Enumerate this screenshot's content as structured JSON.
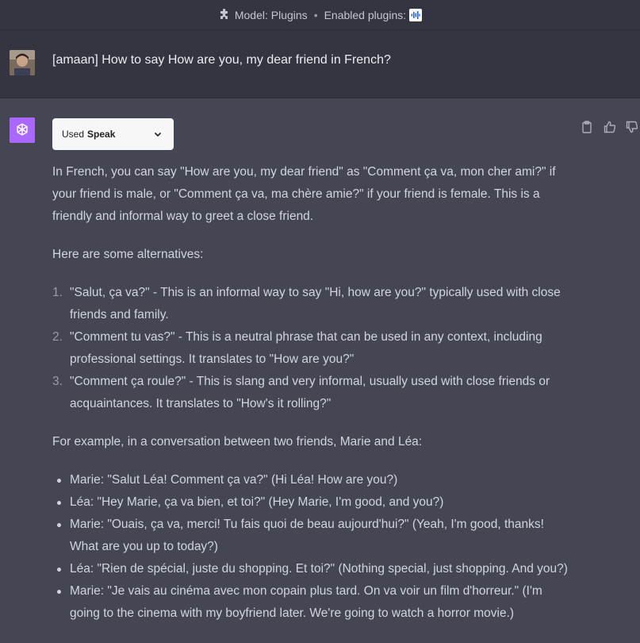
{
  "header": {
    "model_label": "Model: Plugins",
    "separator": "•",
    "enabled_plugins_label": "Enabled plugins:"
  },
  "user_message": {
    "text": "[amaan] How to say How are you, my dear friend in French?"
  },
  "assistant": {
    "plugin_pill": {
      "prefix": "Used",
      "name": "Speak"
    },
    "intro": "In French, you can say \"How are you, my dear friend\" as \"Comment ça va, mon cher ami?\" if your friend is male, or \"Comment ça va, ma chère amie?\" if your friend is female. This is a friendly and informal way to greet a close friend.",
    "alternatives_heading": "Here are some alternatives:",
    "alternatives": [
      {
        "num": "1.",
        "text": "\"Salut, ça va?\" - This is an informal way to say \"Hi, how are you?\" typically used with close friends and family."
      },
      {
        "num": "2.",
        "text": "\"Comment tu vas?\" - This is a neutral phrase that can be used in any context, including professional settings. It translates to \"How are you?\""
      },
      {
        "num": "3.",
        "text": "\"Comment ça roule?\" - This is slang and very informal, usually used with close friends or acquaintances. It translates to \"How's it rolling?\""
      }
    ],
    "example_heading": "For example, in a conversation between two friends, Marie and Léa:",
    "dialogue": [
      "Marie: \"Salut Léa! Comment ça va?\" (Hi Léa! How are you?)",
      "Léa: \"Hey Marie, ça va bien, et toi?\" (Hey Marie, I'm good, and you?)",
      "Marie: \"Ouais, ça va, merci! Tu fais quoi de beau aujourd'hui?\" (Yeah, I'm good, thanks! What are you up to today?)",
      "Léa: \"Rien de spécial, juste du shopping. Et toi?\" (Nothing special, just shopping. And you?)",
      "Marie: \"Je vais au cinéma avec mon copain plus tard. On va voir un film d'horreur.\" (I'm going to the cinema with my boyfriend later. We're going to watch a horror movie.)"
    ]
  },
  "colors": {
    "page_bg": "#444654",
    "user_bg": "#343541",
    "gpt_logo_bg": "#ab68ff",
    "plugin_pill_bg": "#f7f7f8"
  },
  "icons": [
    "puzzle-icon",
    "speak-plugin-icon",
    "user-avatar",
    "openai-logo-icon",
    "chevron-down-icon",
    "clipboard-icon",
    "thumbs-up-icon",
    "thumbs-down-icon"
  ]
}
